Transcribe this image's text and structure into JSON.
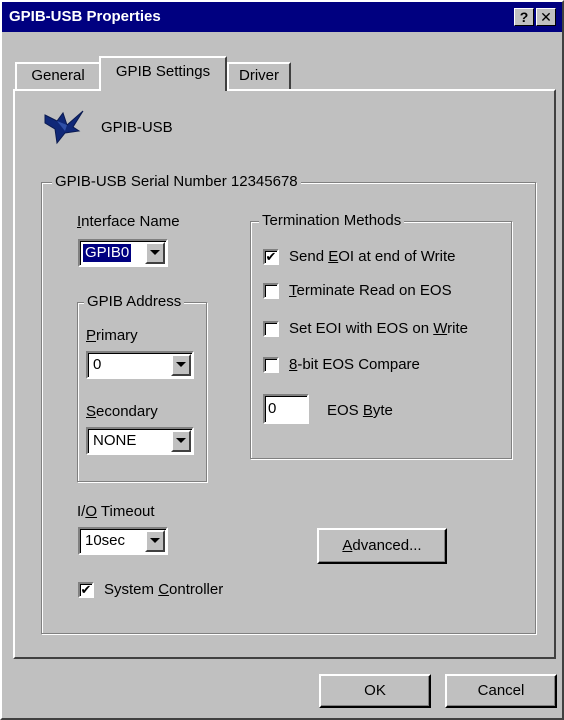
{
  "window": {
    "title": "GPIB-USB Properties",
    "help_button": "?",
    "close_button": "✕"
  },
  "tabs": [
    {
      "label": "General",
      "active": false
    },
    {
      "label": "GPIB Settings",
      "active": true
    },
    {
      "label": "Driver",
      "active": false
    }
  ],
  "device": {
    "name": "GPIB-USB",
    "icon": "national-instruments-eagle-logo"
  },
  "serial_group": {
    "title": "GPIB-USB Serial Number 12345678"
  },
  "interface_name": {
    "label_prefix": "I",
    "label_rest": "nterface Name",
    "value": "GPIB0"
  },
  "gpib_address": {
    "title": "GPIB Address",
    "primary_label_prefix": "P",
    "primary_label_rest": "rimary",
    "primary_value": "0",
    "secondary_label_prefix": "S",
    "secondary_label_rest": "econdary",
    "secondary_value": "NONE"
  },
  "termination": {
    "title": "Termination Methods",
    "options": [
      {
        "pre": "Send ",
        "key": "E",
        "post": "OI at end of Write",
        "checked": true
      },
      {
        "pre": "",
        "key": "T",
        "post": "erminate Read on EOS",
        "checked": false
      },
      {
        "pre": "Set EOI with EOS on ",
        "key": "W",
        "post": "rite",
        "checked": false
      },
      {
        "pre": "",
        "key": "8",
        "post": "-bit EOS Compare",
        "checked": false
      }
    ],
    "eos_value": "0",
    "eos_label_pre": "EOS ",
    "eos_label_key": "B",
    "eos_label_post": "yte"
  },
  "io_timeout": {
    "label_pre": "I/",
    "label_key": "O",
    "label_post": " Timeout",
    "value": "10sec"
  },
  "system_controller": {
    "checked": true,
    "label_pre": "System ",
    "label_key": "C",
    "label_post": "ontroller"
  },
  "buttons": {
    "advanced_key": "A",
    "advanced_rest": "dvanced...",
    "ok": "OK",
    "cancel": "Cancel"
  },
  "check_glyph": "✔"
}
